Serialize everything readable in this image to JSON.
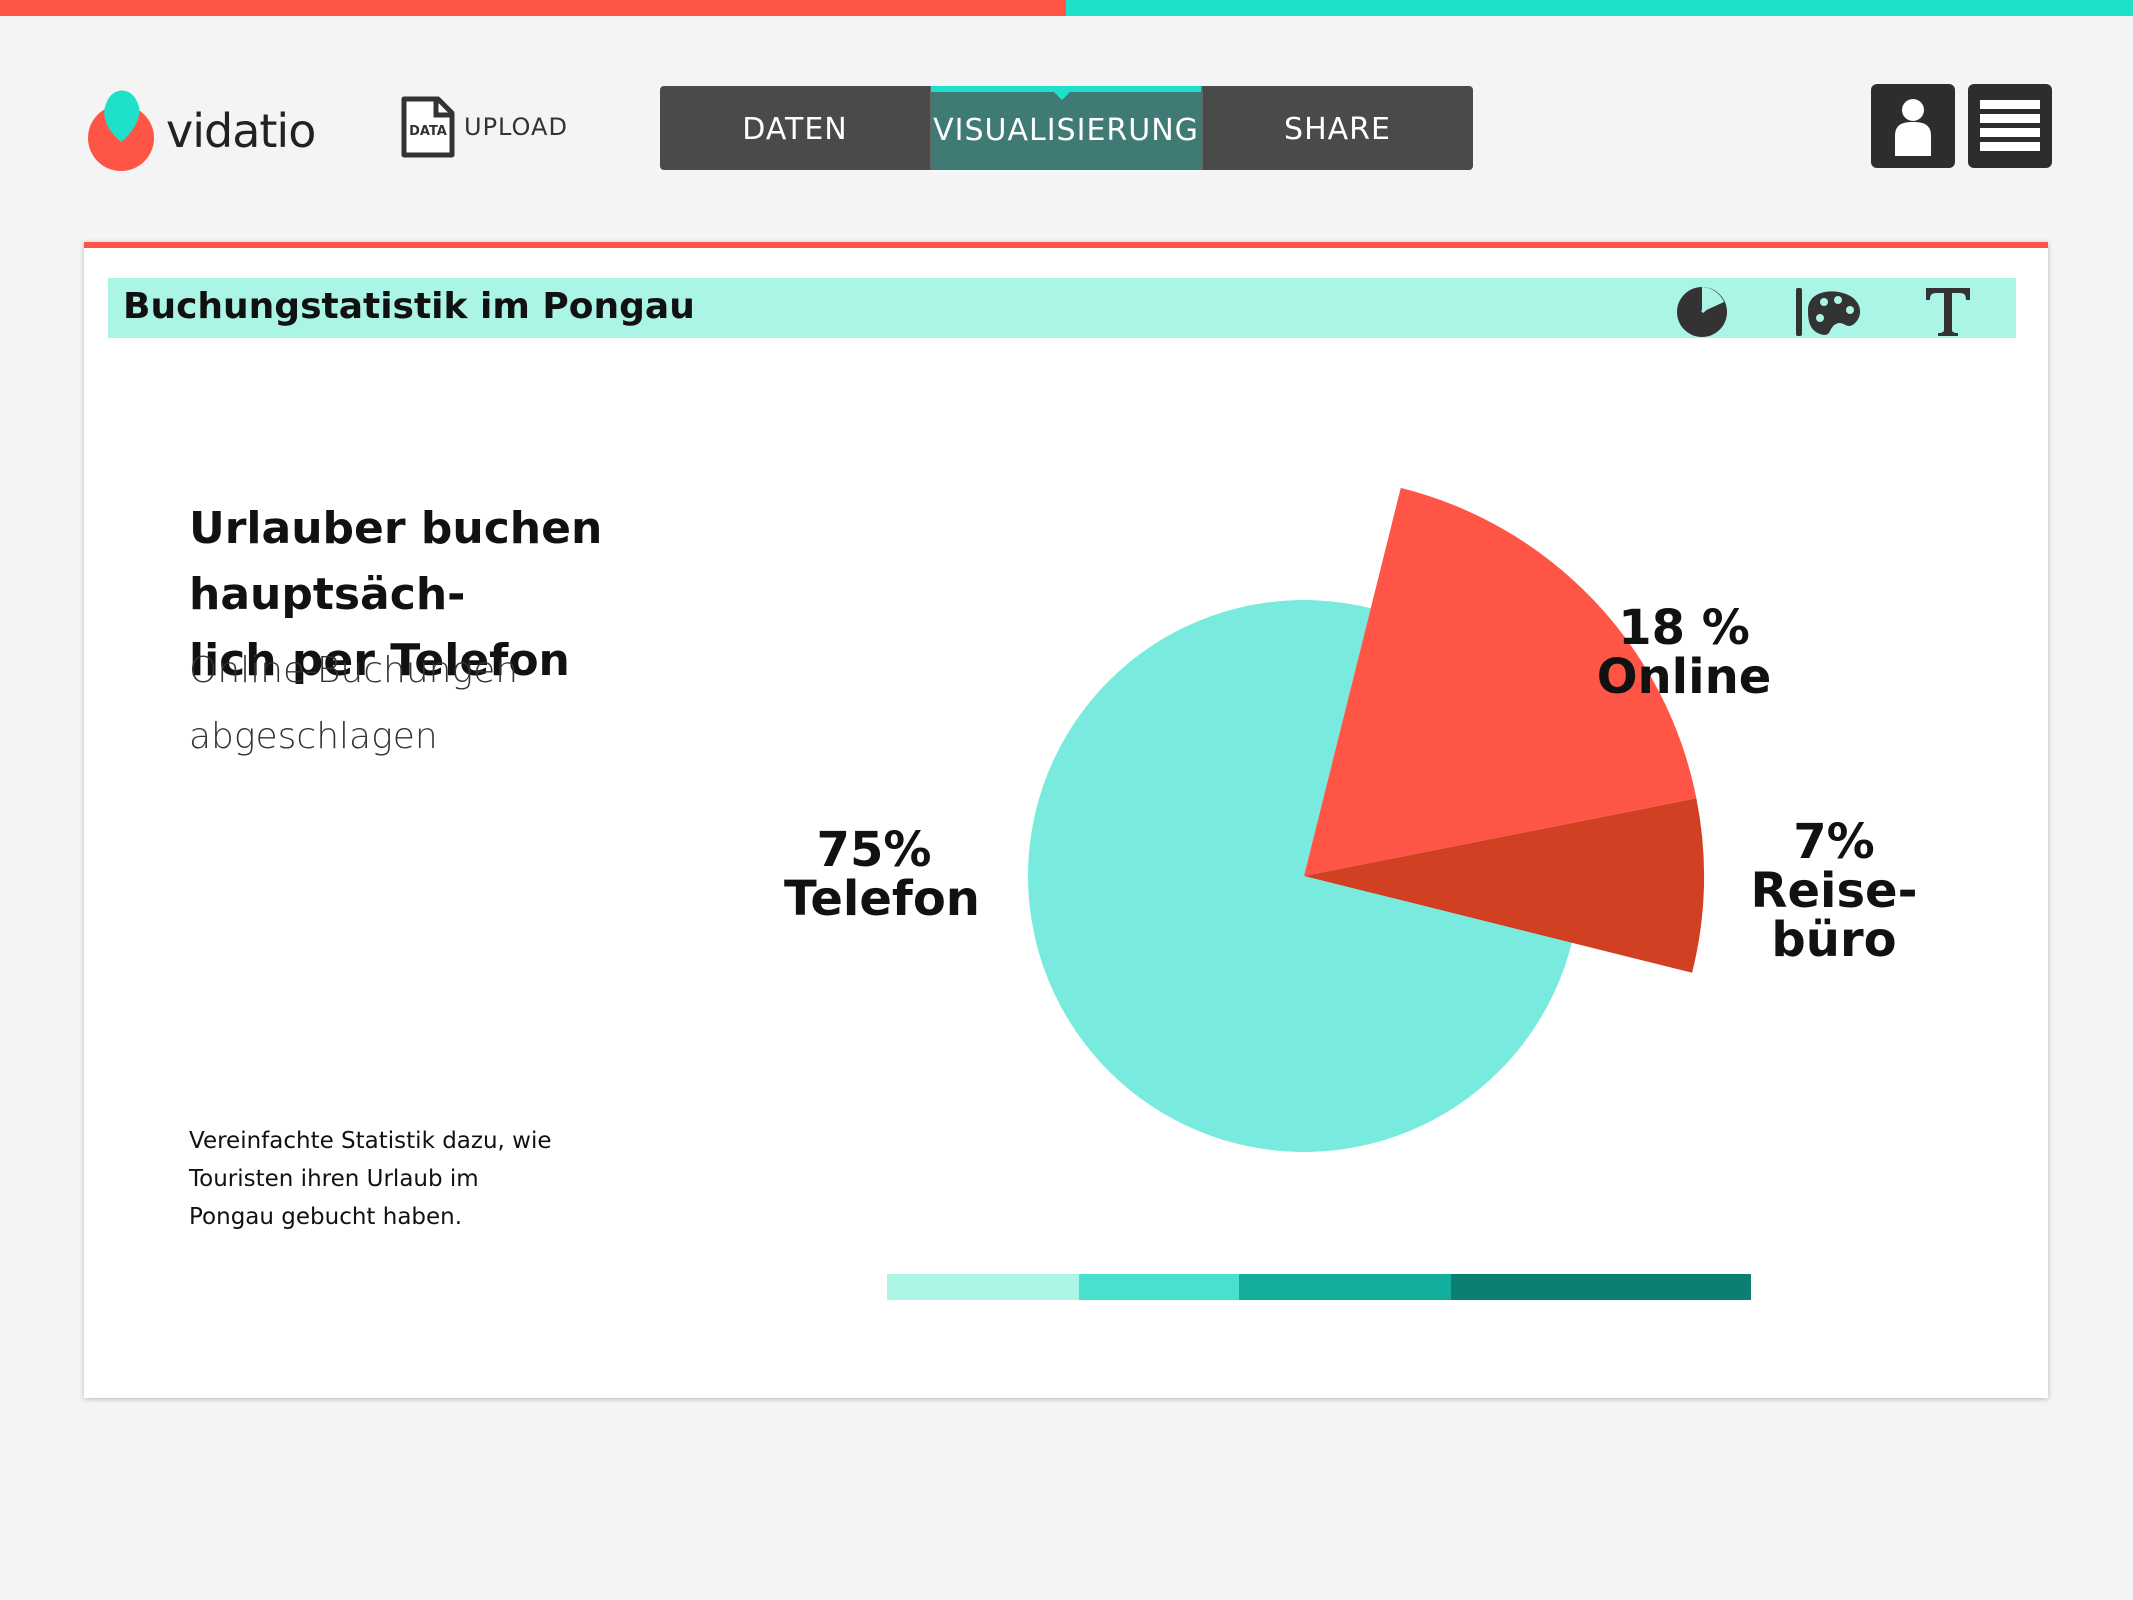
{
  "colors": {
    "top_left": "#ff5546",
    "top_right": "#1fe0ca",
    "tab_bg": "#4a4a4a",
    "tab_active": "#3f7a74",
    "titlebar_bg": "#aaf5e6",
    "slice_telefon": "#78ebde",
    "slice_online": "#ff5546",
    "slice_reisebuero": "#d24023"
  },
  "logo": {
    "text": "vidatio",
    "icon": "vidatio-logo-icon"
  },
  "upload": {
    "icon_text": "DATA",
    "label": "UPLOAD",
    "icon": "data-file-icon"
  },
  "tabs": [
    {
      "label": "DATEN",
      "active": false
    },
    {
      "label": "VISUALISIERUNG",
      "active": true
    },
    {
      "label": "SHARE",
      "active": false
    }
  ],
  "header_icons": [
    "user-icon",
    "menu-icon"
  ],
  "panel": {
    "title": "Buchungstatistik im Pongau",
    "tools": [
      "pie-chart-icon",
      "palette-icon",
      "text-icon"
    ]
  },
  "text": {
    "headline_line1": "Urlauber buchen hauptsäch-",
    "headline_line2": "lich per Telefon",
    "sub_line1": "Online-Buchungen",
    "sub_line2": "abgeschlagen",
    "note_line1": "Vereinfachte Statistik dazu, wie",
    "note_line2": "Touristen ihren Urlaub im",
    "note_line3": "Pongau gebucht haben."
  },
  "chart_data": {
    "type": "pie",
    "categories": [
      "Telefon",
      "Online",
      "Reisebüro"
    ],
    "values": [
      75,
      18,
      7
    ],
    "exploded": [
      false,
      true,
      true
    ],
    "labels": {
      "telefon": {
        "pct": "75%",
        "name": "Telefon"
      },
      "online": {
        "pct": "18 %",
        "name": "Online"
      },
      "reise": {
        "pct": "7%",
        "name1": "Reise-",
        "name2": "büro"
      }
    }
  },
  "color_scale": [
    "#aaf5e6",
    "#49e0cd",
    "#13ae9c",
    "#0b8072"
  ]
}
